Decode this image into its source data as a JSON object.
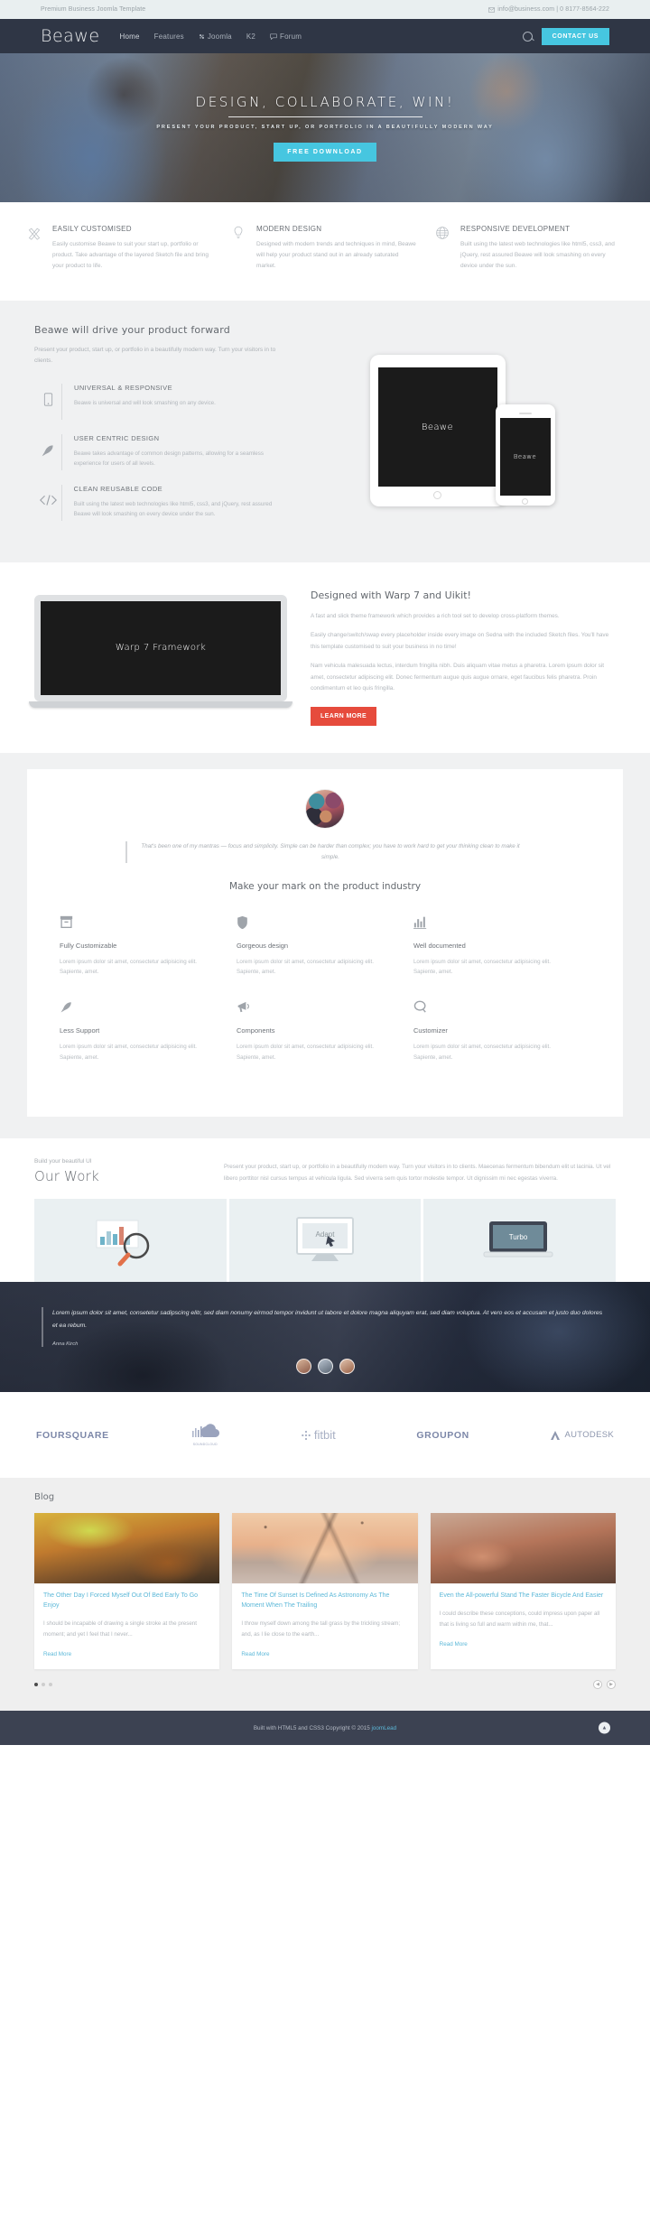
{
  "topbar": {
    "tagline": "Premium Business Joomla Template",
    "email_icon": "envelope-icon",
    "contact": "info@business.com | 0 8177-8564-222"
  },
  "nav": {
    "brand": "Beawe",
    "links": [
      {
        "label": "Home",
        "icon": null,
        "active": true
      },
      {
        "label": "Features",
        "icon": null,
        "active": false
      },
      {
        "label": "Joomla",
        "icon": "joomla-icon",
        "active": false
      },
      {
        "label": "K2",
        "icon": null,
        "active": false
      },
      {
        "label": "Forum",
        "icon": "comment-icon",
        "active": false
      }
    ],
    "search_icon": "search-icon",
    "contact_button": "CONTACT US"
  },
  "hero": {
    "title": "DESIGN, COLLABORATE, WIN!",
    "subtitle": "PRESENT YOUR PRODUCT, START UP, OR PORTFOLIO IN A BEAUTIFULLY MODERN WAY",
    "button": "FREE DOWNLOAD"
  },
  "features3": [
    {
      "icon": "pencils-cross-icon",
      "title": "EASILY CUSTOMISED",
      "text": "Easily customise Beawe to suit your start up, portfolio or product. Take advantage of the layered Sketch file and bring your product to life."
    },
    {
      "icon": "lightbulb-icon",
      "title": "MODERN DESIGN",
      "text": "Designed with modern trends and techniques in mind, Beawe will help your product stand out in an already saturated market."
    },
    {
      "icon": "globe-icon",
      "title": "RESPONSIVE DEVELOPMENT",
      "text": "Built using the latest web technologies like html5, css3, and jQuery, rest assured Beawe will look smashing on every device under the sun."
    }
  ],
  "drive": {
    "heading": "Beawe will drive your product forward",
    "intro": "Present your product, start up, or portfolio in a beautifully modern way. Turn your visitors in to clients.",
    "items": [
      {
        "icon": "mobile-icon",
        "title": "UNIVERSAL & RESPONSIVE",
        "text": "Beawe is universal and will look smashing on any device."
      },
      {
        "icon": "rocket-icon",
        "title": "USER CENTRIC DESIGN",
        "text": "Beawe takes advantage of common design patterns, allowing for a seamless experience for users of all levels."
      },
      {
        "icon": "code-icon",
        "title": "CLEAN REUSABLE CODE",
        "text": "Built using the latest web technologies like html5, css3, and jQuery, rest assured Beawe will look smashing on every device under the sun."
      }
    ],
    "device_screen_label": "Beawe",
    "phone_screen_label": "Beawe"
  },
  "warp": {
    "laptop_screen_label": "Warp 7 Framework",
    "heading": "Designed with Warp 7 and Uikit!",
    "p1": "A fast and slick theme framework which provides a rich tool set to develop cross-platform themes.",
    "p2": "Easily change/switch/swap every placeholder inside every image on Sedna with the included Sketch files. You'll have this template customised to suit your business in no time!",
    "p3": "Nam vehicula malesuada lectus, interdum fringilla nibh. Duis aliquam vitae metus a pharetra. Lorem ipsum dolor sit amet, consectetur adipiscing elit. Donec fermentum augue quis augue ornare, eget faucibus felis pharetra. Proin condimentum et leo quis fringilla.",
    "button": "LEARN MORE"
  },
  "mark": {
    "avatar": "avatar",
    "quote": "That's been one of my mantras — focus and simplicity. Simple can be harder than complex; you have to work hard to get your thinking clean to make it simple.",
    "heading": "Make your mark on the product industry",
    "items": [
      {
        "icon": "archive-icon",
        "title": "Fully Customizable",
        "text": "Lorem ipsum dolor sit amet, consectetur adipisicing elit. Sapiente, amet."
      },
      {
        "icon": "shield-icon",
        "title": "Gorgeous design",
        "text": "Lorem ipsum dolor sit amet, consectetur adipisicing elit. Sapiente, amet."
      },
      {
        "icon": "bar-chart-icon",
        "title": "Well documented",
        "text": "Lorem ipsum dolor sit amet, consectetur adipisicing elit. Sapiente, amet."
      },
      {
        "icon": "rocket-icon",
        "title": "Less Support",
        "text": "Lorem ipsum dolor sit amet, consectetur adipisicing elit. Sapiente, amet."
      },
      {
        "icon": "megaphone-icon",
        "title": "Components",
        "text": "Lorem ipsum dolor sit amet, consectetur adipisicing elit. Sapiente, amet."
      },
      {
        "icon": "comment-icon",
        "title": "Customizer",
        "text": "Lorem ipsum dolor sit amet, consectetur adipisicing elit. Sapiente, amet."
      }
    ]
  },
  "work": {
    "kicker": "Build your beautiful UI",
    "heading": "Our Work",
    "text": "Present your product, start up, or portfolio in a beautifully modern way. Turn your visitors in to clients. Maecenas fermentum bibendum elit ut lacinia. Ut vel libero porttitor nisl cursus tempus at vehicula ligula. Sed viverra sem quis tortor molestie tempor. Ut dignissim mi nec egestas viverra.",
    "tiles": [
      {
        "name": "analytics-magnifier-illustration"
      },
      {
        "name": "monitor-cursor-illustration"
      },
      {
        "name": "laptop-turbo-illustration"
      }
    ]
  },
  "darkquote": {
    "quote": "Lorem ipsum dolor sit amet, consetetur sadipscing elitr, sed diam nonumy eirmod tempor invidunt ut labore et dolore magna aliquyam erat, sed diam voluptua. At vero eos et accusam et justo duo dolores et ea rebum.",
    "author": "Anna Kirch",
    "avatars": [
      "testimonial-avatar-1",
      "testimonial-avatar-2",
      "testimonial-avatar-3"
    ]
  },
  "logos": [
    {
      "name": "foursquare-logo",
      "label": "FOURSQUARE",
      "style": "bold"
    },
    {
      "name": "soundcloud-logo",
      "label": "SOUNDCLOUD",
      "style": "cloud"
    },
    {
      "name": "fitbit-logo",
      "label": "fitbit",
      "style": "light"
    },
    {
      "name": "groupon-logo",
      "label": "GROUPON",
      "style": "bold"
    },
    {
      "name": "autodesk-logo",
      "label": "AUTODESK",
      "style": "thin"
    }
  ],
  "blog": {
    "heading": "Blog",
    "posts": [
      {
        "image": "autumn-leaves-photo",
        "title": "The Other Day I Forced Myself Out Of Bed Early To Go Enjoy",
        "excerpt": "I should be incapable of drawing a single stroke at the present moment; and yet I feel that I never...",
        "more": "Read More"
      },
      {
        "image": "winter-sunset-trees-photo",
        "title": "The Time Of Sunset Is Defined As Astronomy As The Moment When The Trailing",
        "excerpt": "I throw myself down among the tall grass by the trickling stream; and, as I lie close to the earth...",
        "more": "Read More"
      },
      {
        "image": "bicycle-photo",
        "title": "Even the All-powerful Stand The Faster Bicycle And Easier",
        "excerpt": "I could describe these conceptions, could impress upon paper all that is living so full and warm within me, that...",
        "more": "Read More"
      }
    ],
    "dots": 3,
    "active_dot": 0,
    "prev_icon": "chevron-left-icon",
    "next_icon": "chevron-right-icon"
  },
  "footer": {
    "text": "Built with HTML5 and CSS3 Copyright © 2015 ",
    "link": "joomLead",
    "to_top_icon": "chevron-up-icon"
  },
  "colors": {
    "accent": "#46c6e0",
    "nav_bg": "#2f3645",
    "learn_more": "#e64b3c",
    "link": "#5cb8d8",
    "footer_bg": "#3c4252"
  }
}
